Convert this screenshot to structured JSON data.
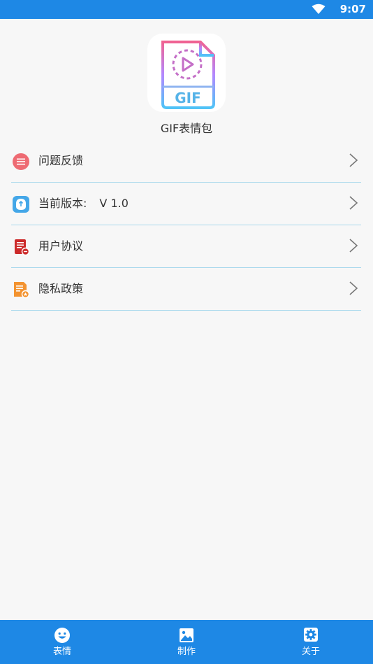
{
  "status_bar": {
    "time": "9:07",
    "background": "#1e88e5"
  },
  "app": {
    "name": "GIF表情包",
    "icon_text": "GIF"
  },
  "menu": {
    "items": [
      {
        "label": "问题反馈",
        "icon": "feedback-icon",
        "icon_color": "#ee6b73"
      },
      {
        "label": "当前版本:",
        "value": "V 1.0",
        "icon": "version-icon",
        "icon_color": "#44a7e8"
      },
      {
        "label": "用户协议",
        "icon": "user-agreement-icon",
        "icon_color": "#cc2a2a"
      },
      {
        "label": "隐私政策",
        "icon": "privacy-policy-icon",
        "icon_color": "#f39330"
      }
    ]
  },
  "bottom_nav": {
    "tabs": [
      {
        "label": "表情",
        "icon": "smiley-icon"
      },
      {
        "label": "制作",
        "icon": "image-icon"
      },
      {
        "label": "关于",
        "icon": "settings-gear-icon"
      }
    ]
  }
}
